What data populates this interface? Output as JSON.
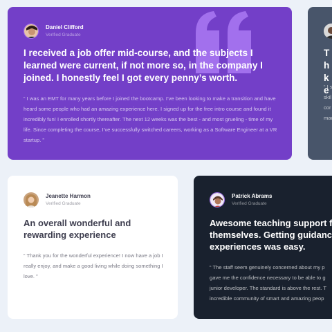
{
  "colors": {
    "page_background": "#ECF1F8",
    "purple": "#733FC8",
    "grayish_blue": "#48556A",
    "dark_blue": "#19212E",
    "white": "#FFFFFF",
    "light_purple": "#A775F1",
    "quote_mark": "#A775F1"
  },
  "testimonials": [
    {
      "name": "Daniel Clifford",
      "status": "Verified Graduate",
      "avatar_icon": "avatar-daniel",
      "headline": "I received a job offer mid-course, and the subjects I learned were current, if not more so, in the company I joined. I honestly feel I got every penny’s worth.",
      "quote": "“ I was an EMT for many years before I joined the bootcamp. I’ve been looking to make a transition and have heard some people who had an amazing experience here. I signed up for the free intro course and found it incredibly fun! I enrolled shortly thereafter. The next 12 weeks was the best - and most grueling - time of my life. Since completing the course, I’ve successfully switched careers, working as a Software Engineer at a VR startup. ”"
    },
    {
      "name": "",
      "status": "",
      "avatar_icon": "avatar-jonathan",
      "headline": "Th ke",
      "quote_lines": [
        "“ I s",
        "skil",
        "cor",
        "mac"
      ]
    },
    {
      "name": "Jeanette Harmon",
      "status": "Verified Graduate",
      "avatar_icon": "avatar-jeanette",
      "headline": "An overall wonderful and rewarding experience",
      "quote": "“ Thank you for the wonderful experience! I now have a job I really enjoy, and make a good living while doing something I love. ”"
    },
    {
      "name": "Patrick Abrams",
      "status": "Verified Graduate",
      "avatar_icon": "avatar-patrick",
      "headline_lines": [
        "Awesome teaching support from",
        "themselves. Getting guidance fr",
        "experiences was easy."
      ],
      "quote_lines": [
        "“ The staff seem genuinely concerned about my p",
        "gave me the confidence necessary to be able to g",
        "junior developer. The standard is above the rest. T",
        "incredible community of smart and amazing peop"
      ]
    }
  ]
}
